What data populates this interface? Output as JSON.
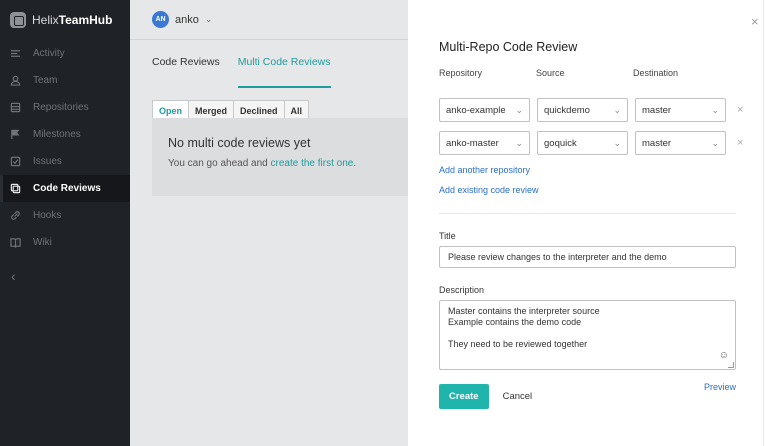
{
  "brand": {
    "prefix": "Helix",
    "name": "TeamHub"
  },
  "sidebar": {
    "items": [
      {
        "label": "Activity",
        "icon": "activity-icon"
      },
      {
        "label": "Team",
        "icon": "user-icon"
      },
      {
        "label": "Repositories",
        "icon": "repository-icon"
      },
      {
        "label": "Milestones",
        "icon": "flag-icon"
      },
      {
        "label": "Issues",
        "icon": "checkbox-icon"
      },
      {
        "label": "Code Reviews",
        "icon": "code-review-icon",
        "active": true
      },
      {
        "label": "Hooks",
        "icon": "link-icon"
      },
      {
        "label": "Wiki",
        "icon": "book-icon"
      }
    ],
    "collapse_glyph": "‹"
  },
  "user": {
    "initials": "AN",
    "name": "anko",
    "chevron": "⌄"
  },
  "main": {
    "tabs": [
      {
        "label": "Code Reviews",
        "active": false
      },
      {
        "label": "Multi Code Reviews",
        "active": true
      }
    ],
    "filters": [
      {
        "label": "Open",
        "active": true
      },
      {
        "label": "Merged",
        "active": false
      },
      {
        "label": "Declined",
        "active": false
      },
      {
        "label": "All",
        "active": false
      }
    ],
    "empty": {
      "title": "No multi code reviews yet",
      "text_prefix": "You can go ahead and ",
      "link": "create the first one",
      "text_suffix": "."
    }
  },
  "panel": {
    "close_glyph": "×",
    "title": "Multi-Repo Code Review",
    "columns": {
      "repository": "Repository",
      "source": "Source",
      "destination": "Destination"
    },
    "rows": [
      {
        "repository": "anko-example",
        "source": "quickdemo",
        "destination": "master"
      },
      {
        "repository": "anko-master",
        "source": "goquick",
        "destination": "master"
      }
    ],
    "add_repo_link": "Add another repository",
    "add_existing_link": "Add existing code review",
    "title_label": "Title",
    "title_value": "Please review changes to the interpreter and the demo",
    "description_label": "Description",
    "description_lines": [
      "Master contains the interpreter source",
      "Example contains the demo code",
      "",
      "They need to be reviewed together"
    ],
    "create_label": "Create",
    "cancel_label": "Cancel",
    "preview_label": "Preview"
  },
  "colors": {
    "accent": "#1fb5ad",
    "link": "#2a6fc9",
    "sidebar_bg": "#1f2226"
  }
}
